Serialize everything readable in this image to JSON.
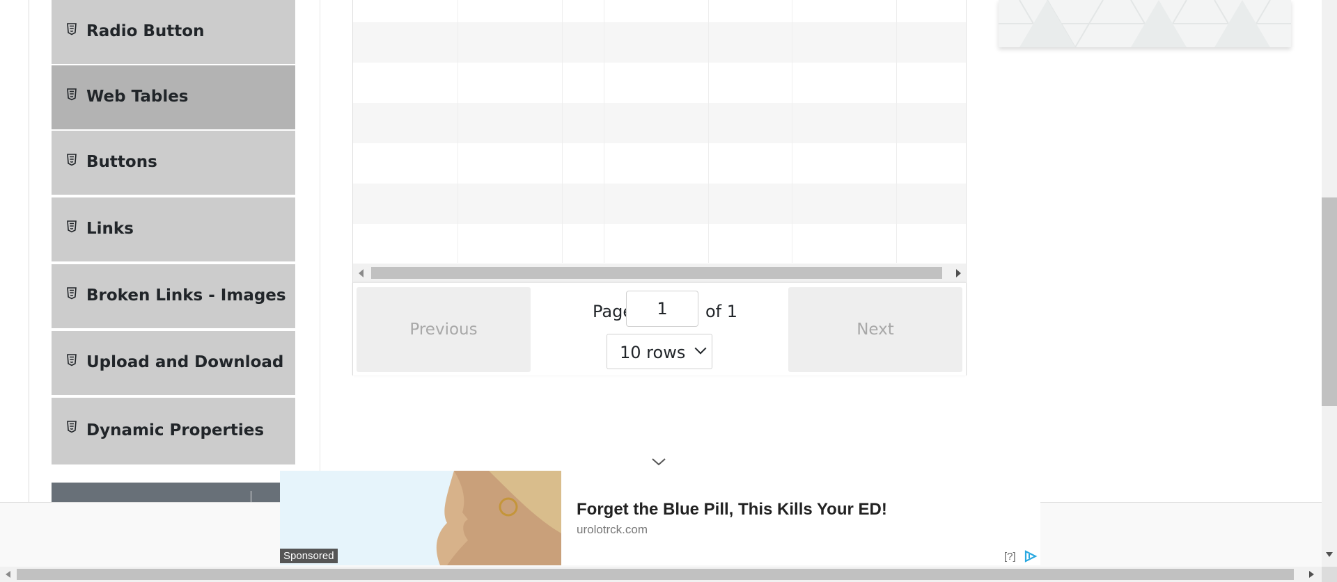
{
  "sidebar": {
    "items": [
      {
        "label": "Radio Button",
        "icon": "html5-icon"
      },
      {
        "label": "Web Tables",
        "icon": "html5-icon",
        "active": true
      },
      {
        "label": "Buttons",
        "icon": "html5-icon"
      },
      {
        "label": "Links",
        "icon": "html5-icon"
      },
      {
        "label": "Broken Links - Images",
        "icon": "html5-icon"
      },
      {
        "label": "Upload and Download",
        "icon": "html5-icon"
      },
      {
        "label": "Dynamic Properties",
        "icon": "html5-icon"
      }
    ]
  },
  "table": {
    "pagination": {
      "previous_label": "Previous",
      "next_label": "Next",
      "page_label": "Page",
      "page_value": "1",
      "of_label": "of 1",
      "rows_selected": "10 rows"
    }
  },
  "ad": {
    "sponsored_label": "Sponsored",
    "title": "Forget the Blue Pill, This Kills Your ED!",
    "domain": "urolotrck.com",
    "info_label": "[?]"
  },
  "colors": {
    "sidebar_item_bg": "#cccccc",
    "sidebar_item_active_bg": "#b3b3b3",
    "collapsed_group_bg": "#687078"
  }
}
